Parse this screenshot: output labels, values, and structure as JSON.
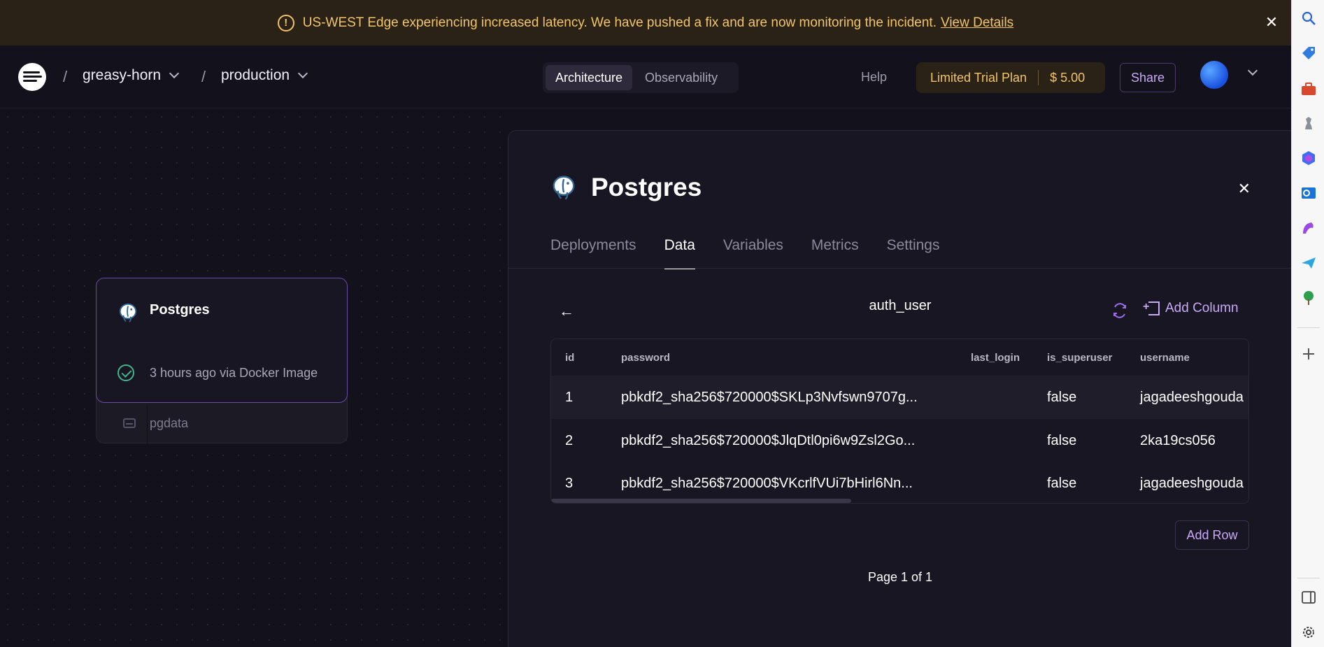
{
  "banner": {
    "message": "US-WEST Edge experiencing increased latency. We have pushed a fix and are now monitoring the incident.",
    "link": "View Details",
    "warning_glyph": "!",
    "close_glyph": "✕"
  },
  "header": {
    "separator": "/",
    "project": "greasy-horn",
    "environment": "production",
    "view_tabs": [
      "Architecture",
      "Observability"
    ],
    "help": "Help",
    "plan_name": "Limited Trial Plan",
    "plan_amount": "$ 5.00",
    "share": "Share"
  },
  "canvas": {
    "service_name": "Postgres",
    "deploy_status": "3 hours ago via Docker Image",
    "volume_name": "pgdata"
  },
  "panel": {
    "title": "Postgres",
    "close_glyph": "✕",
    "tabs": [
      "Deployments",
      "Data",
      "Variables",
      "Metrics",
      "Settings"
    ],
    "back_glyph": "←",
    "table_name": "auth_user",
    "add_column": "Add Column",
    "columns": [
      "id",
      "password",
      "last_login",
      "is_superuser",
      "username"
    ],
    "rows": [
      {
        "id": "1",
        "password": "pbkdf2_sha256$720000$SKLp3Nvfswn9707g...",
        "last_login": "",
        "is_superuser": "false",
        "username": "jagadeeshgouda"
      },
      {
        "id": "2",
        "password": "pbkdf2_sha256$720000$JlqDtl0pi6w9Zsl2Go...",
        "last_login": "",
        "is_superuser": "false",
        "username": "2ka19cs056"
      },
      {
        "id": "3",
        "password": "pbkdf2_sha256$720000$VKcrlfVUi7bHirl6Nn...",
        "last_login": "",
        "is_superuser": "false",
        "username": "jagadeeshgouda"
      }
    ],
    "add_row": "Add Row",
    "page_info": "Page 1 of 1"
  },
  "colors": {
    "accent": "#c9a9f5",
    "warning": "#f2c46a",
    "success": "#3fb68b"
  }
}
